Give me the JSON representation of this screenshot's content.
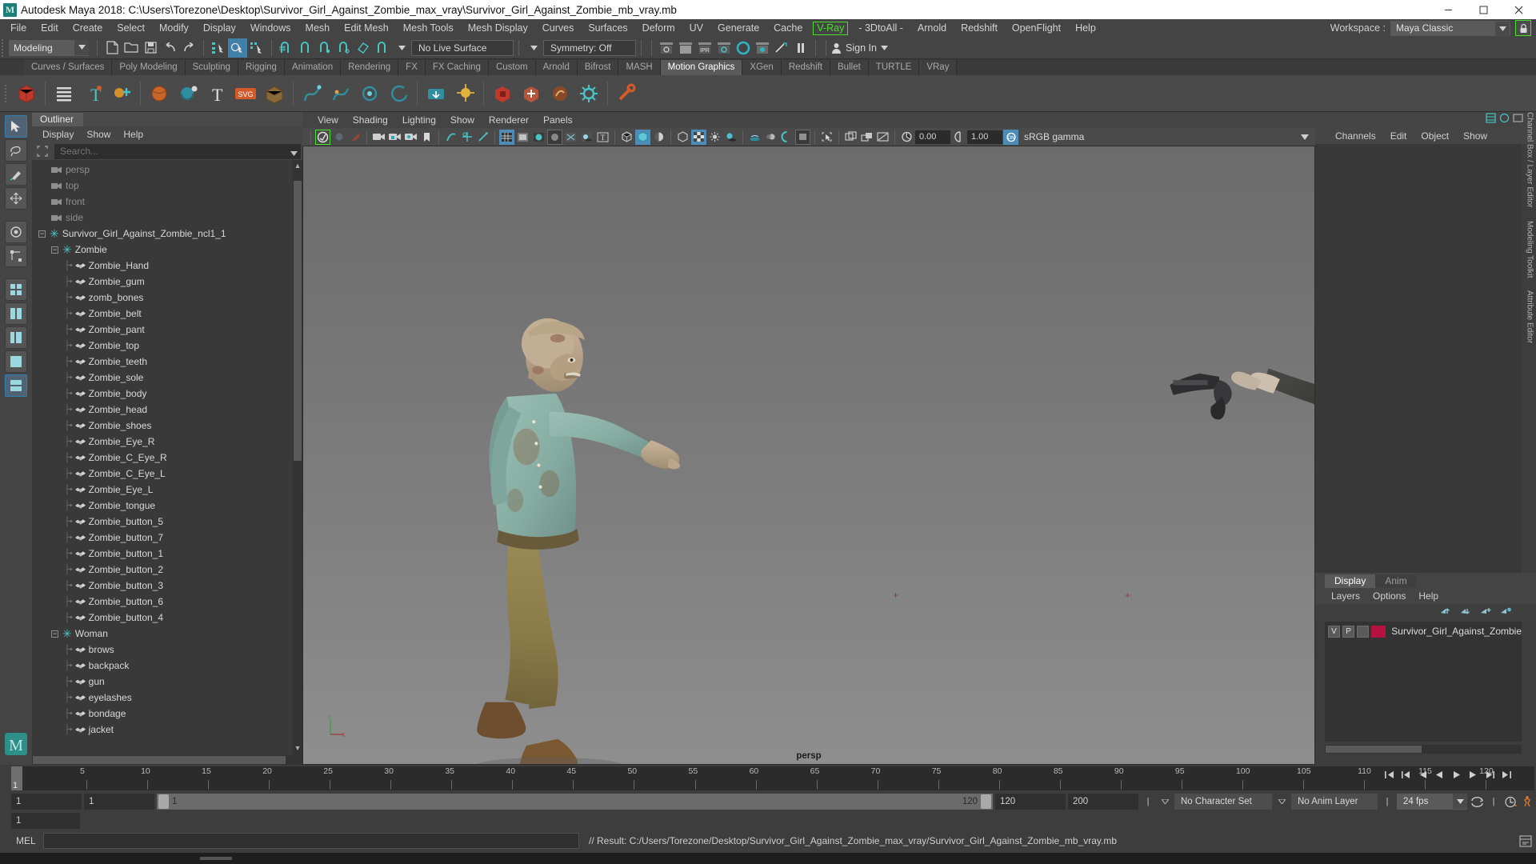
{
  "window": {
    "title": "Autodesk Maya 2018: C:\\Users\\Torezone\\Desktop\\Survivor_Girl_Against_Zombie_max_vray\\Survivor_Girl_Against_Zombie_mb_vray.mb",
    "logo": "M",
    "minimize": "minimize-icon",
    "maximize": "maximize-icon",
    "close": "close-icon"
  },
  "menubar": {
    "items": [
      "File",
      "Edit",
      "Create",
      "Select",
      "Modify",
      "Display",
      "Windows",
      "Mesh",
      "Edit Mesh",
      "Mesh Tools",
      "Mesh Display",
      "Curves",
      "Surfaces",
      "Deform",
      "UV",
      "Generate",
      "Cache"
    ],
    "vray": "V-Ray",
    "items_after": [
      "- 3DtoAll -",
      "Arnold",
      "Redshift",
      "OpenFlight",
      "Help"
    ],
    "workspace_label": "Workspace :",
    "workspace_value": "Maya Classic",
    "lock_icon": "lock-icon"
  },
  "statusbar": {
    "mode": "Modeling",
    "live_surface": "No Live Surface",
    "symmetry": "Symmetry: Off",
    "signin": "Sign In"
  },
  "shelf": {
    "tabs": [
      "Curves / Surfaces",
      "Poly Modeling",
      "Sculpting",
      "Rigging",
      "Animation",
      "Rendering",
      "FX",
      "FX Caching",
      "Custom",
      "Arnold",
      "Bifrost",
      "MASH",
      "Motion Graphics",
      "XGen",
      "Redshift",
      "Bullet",
      "TURTLE",
      "VRay"
    ],
    "active_tab": "Motion Graphics"
  },
  "outliner": {
    "tab": "Outliner",
    "menus": [
      "Display",
      "Show",
      "Help"
    ],
    "search_placeholder": "Search...",
    "search_value": "",
    "tree": [
      {
        "label": "persp",
        "type": "camera",
        "depth": 1
      },
      {
        "label": "top",
        "type": "camera",
        "depth": 1
      },
      {
        "label": "front",
        "type": "camera",
        "depth": 1
      },
      {
        "label": "side",
        "type": "camera",
        "depth": 1
      },
      {
        "label": "Survivor_Girl_Against_Zombie_ncl1_1",
        "type": "group",
        "depth": 0,
        "expanded": true
      },
      {
        "label": "Zombie",
        "type": "group",
        "depth": 1,
        "expanded": true
      },
      {
        "label": "Zombie_Hand",
        "type": "mesh",
        "depth": 2
      },
      {
        "label": "Zombie_gum",
        "type": "mesh",
        "depth": 2
      },
      {
        "label": "zomb_bones",
        "type": "mesh",
        "depth": 2
      },
      {
        "label": "Zombie_belt",
        "type": "mesh",
        "depth": 2
      },
      {
        "label": "Zombie_pant",
        "type": "mesh",
        "depth": 2
      },
      {
        "label": "Zombie_top",
        "type": "mesh",
        "depth": 2
      },
      {
        "label": "Zombie_teeth",
        "type": "mesh",
        "depth": 2
      },
      {
        "label": "Zombie_sole",
        "type": "mesh",
        "depth": 2
      },
      {
        "label": "Zombie_body",
        "type": "mesh",
        "depth": 2
      },
      {
        "label": "Zombie_head",
        "type": "mesh",
        "depth": 2
      },
      {
        "label": "Zombie_shoes",
        "type": "mesh",
        "depth": 2
      },
      {
        "label": "Zombie_Eye_R",
        "type": "mesh",
        "depth": 2
      },
      {
        "label": "Zombie_C_Eye_R",
        "type": "mesh",
        "depth": 2
      },
      {
        "label": "Zombie_C_Eye_L",
        "type": "mesh",
        "depth": 2
      },
      {
        "label": "Zombie_Eye_L",
        "type": "mesh",
        "depth": 2
      },
      {
        "label": "Zombie_tongue",
        "type": "mesh",
        "depth": 2
      },
      {
        "label": "Zombie_button_5",
        "type": "mesh",
        "depth": 2
      },
      {
        "label": "Zombie_button_7",
        "type": "mesh",
        "depth": 2
      },
      {
        "label": "Zombie_button_1",
        "type": "mesh",
        "depth": 2
      },
      {
        "label": "Zombie_button_2",
        "type": "mesh",
        "depth": 2
      },
      {
        "label": "Zombie_button_3",
        "type": "mesh",
        "depth": 2
      },
      {
        "label": "Zombie_button_6",
        "type": "mesh",
        "depth": 2
      },
      {
        "label": "Zombie_button_4",
        "type": "mesh",
        "depth": 2
      },
      {
        "label": "Woman",
        "type": "group",
        "depth": 1,
        "expanded": true
      },
      {
        "label": "brows",
        "type": "mesh",
        "depth": 2
      },
      {
        "label": "backpack",
        "type": "mesh",
        "depth": 2
      },
      {
        "label": "gun",
        "type": "mesh",
        "depth": 2
      },
      {
        "label": "eyelashes",
        "type": "mesh",
        "depth": 2
      },
      {
        "label": "bondage",
        "type": "mesh",
        "depth": 2
      },
      {
        "label": "jacket",
        "type": "mesh",
        "depth": 2
      }
    ]
  },
  "viewport": {
    "menus": [
      "View",
      "Shading",
      "Lighting",
      "Show",
      "Renderer",
      "Panels"
    ],
    "exposure": "0.00",
    "gamma_value": "1.00",
    "color_space": "sRGB gamma",
    "camera_label": "persp"
  },
  "right_panel": {
    "top_menus": [
      "Channels",
      "Edit",
      "Object",
      "Show"
    ],
    "tabs": [
      "Display",
      "Anim"
    ],
    "active_tab": "Display",
    "menus": [
      "Layers",
      "Options",
      "Help"
    ],
    "layers": [
      {
        "v": "V",
        "p": "P",
        "color": "#b5123f",
        "name": "Survivor_Girl_Against_Zombie"
      }
    ],
    "vtabs": [
      "Channel Box / Layer Editor",
      "Modeling Toolkit",
      "Attribute Editor"
    ]
  },
  "timeline": {
    "current_frame": "1",
    "ticks": [
      5,
      10,
      15,
      20,
      25,
      30,
      35,
      40,
      45,
      50,
      55,
      60,
      65,
      70,
      75,
      80,
      85,
      90,
      95,
      100,
      105,
      110,
      115,
      120
    ],
    "range_start_field": "1",
    "range_start2_field": "1",
    "range_bar_start": "1",
    "range_bar_end": "120",
    "end_field": "120",
    "max_field": "200",
    "character_set": "No Character Set",
    "anim_layer": "No Anim Layer",
    "fps": "24 fps",
    "frame_input": "1"
  },
  "command_line": {
    "mel_label": "MEL",
    "input_value": "",
    "result": "// Result: C:/Users/Torezone/Desktop/Survivor_Girl_Against_Zombie_max_vray/Survivor_Girl_Against_Zombie_mb_vray.mb"
  },
  "colors": {
    "accent_teal": "#49c3c3",
    "accent_blue": "#4e8bb5",
    "vray_green": "#46e02a",
    "layer_red": "#b5123f",
    "panel_bg": "#3d3d3d"
  }
}
